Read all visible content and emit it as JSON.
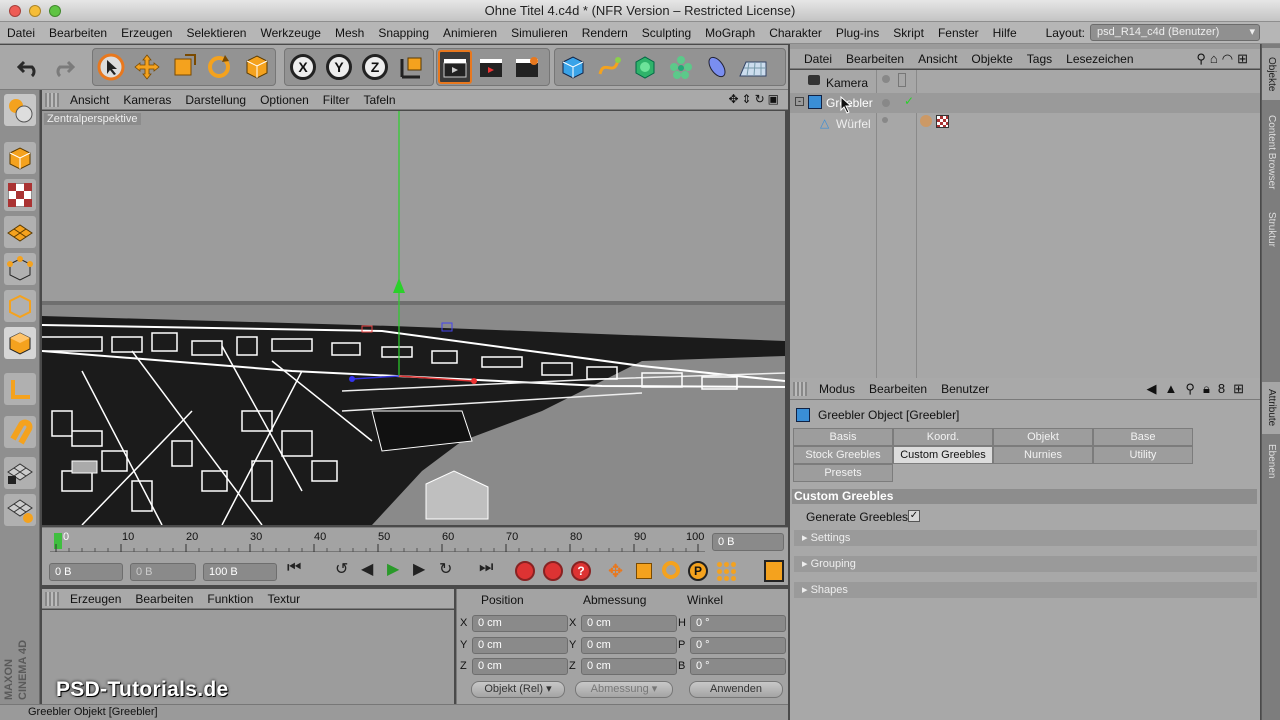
{
  "window": {
    "title": "Ohne Titel 4.c4d * (NFR Version – Restricted License)"
  },
  "menubar": {
    "items": [
      "Datei",
      "Bearbeiten",
      "Erzeugen",
      "Selektieren",
      "Werkzeuge",
      "Mesh",
      "Snapping",
      "Animieren",
      "Simulieren",
      "Rendern",
      "Sculpting",
      "MoGraph",
      "Charakter",
      "Plug-ins",
      "Skript",
      "Fenster",
      "Hilfe"
    ],
    "layout_label": "Layout:",
    "layout_value": "psd_R14_c4d (Benutzer)"
  },
  "toolbar": {
    "axes": [
      "X",
      "Y",
      "Z"
    ]
  },
  "viewport": {
    "menu": [
      "Ansicht",
      "Kameras",
      "Darstellung",
      "Optionen",
      "Filter",
      "Tafeln"
    ],
    "camera_label": "Zentralperspektive"
  },
  "timeline": {
    "ticks": [
      "0",
      "10",
      "20",
      "30",
      "40",
      "50",
      "60",
      "70",
      "80",
      "90",
      "100"
    ],
    "current_frame": "0 B",
    "start": "0 B",
    "preview": "0 B",
    "end": "100 B"
  },
  "material": {
    "menu": [
      "Erzeugen",
      "Bearbeiten",
      "Funktion",
      "Textur"
    ]
  },
  "coords": {
    "headers": [
      "Position",
      "Abmessung",
      "Winkel"
    ],
    "rows": [
      {
        "a": "X",
        "pos": "0 cm",
        "b": "X",
        "size": "0 cm",
        "c": "H",
        "rot": "0 °"
      },
      {
        "a": "Y",
        "pos": "0 cm",
        "b": "Y",
        "size": "0 cm",
        "c": "P",
        "rot": "0 °"
      },
      {
        "a": "Z",
        "pos": "0 cm",
        "b": "Z",
        "size": "0 cm",
        "c": "B",
        "rot": "0 °"
      }
    ],
    "mode": "Objekt (Rel)",
    "size_mode": "Abmessung",
    "apply": "Anwenden"
  },
  "status": {
    "text": "Greebler Objekt [Greebler]"
  },
  "objects": {
    "menu": [
      "Datei",
      "Bearbeiten",
      "Ansicht",
      "Objekte",
      "Tags",
      "Lesezeichen"
    ],
    "items": [
      "Kamera",
      "Greebler",
      "Würfel"
    ]
  },
  "attributes": {
    "menu": [
      "Modus",
      "Bearbeiten",
      "Benutzer"
    ],
    "object_title": "Greebler Object [Greebler]",
    "tabs": [
      "Basis",
      "Koord.",
      "Objekt",
      "Base",
      "Stock Greebles",
      "Custom Greebles",
      "Nurnies",
      "Utility",
      "Presets"
    ],
    "section_title": "Custom Greebles",
    "generate_label": "Generate Greebles",
    "sections": [
      "Settings",
      "Grouping",
      "Shapes"
    ]
  },
  "side_tabs": [
    "Objekte",
    "Content Browser",
    "Struktur",
    "Attribute",
    "Ebenen"
  ],
  "watermark": "PSD-Tutorials.de",
  "brand": {
    "maker": "MAXON",
    "product": "CINEMA 4D"
  },
  "colors": {
    "accent": "#e8781e",
    "timeline_marker": "#3fbf3f",
    "y_axis": "#2bd12b"
  }
}
